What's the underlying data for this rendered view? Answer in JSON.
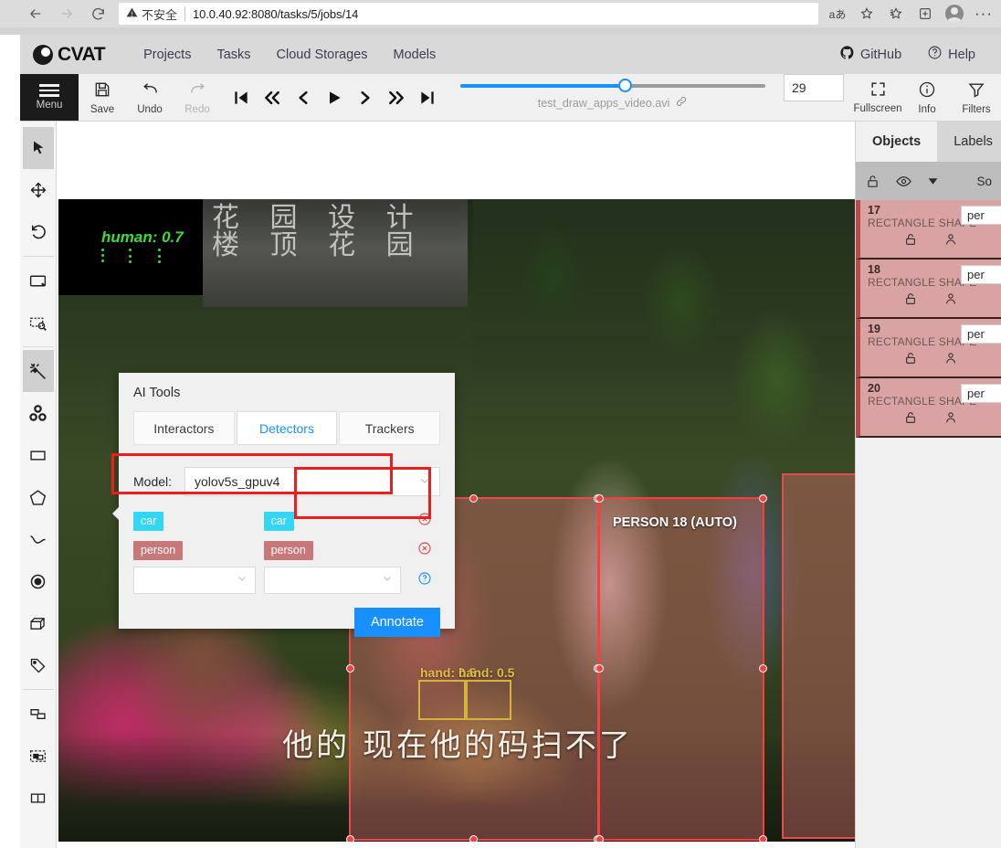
{
  "browser": {
    "back_icon": "arrow-left-icon",
    "forward_icon": "arrow-right-icon",
    "reload_icon": "reload-icon",
    "security_label": "不安全",
    "security_icon": "warning-triangle-icon",
    "url": "10.0.40.92:8080/tasks/5/jobs/14",
    "read_aloud_icon": "read-aloud-icon",
    "favorites_icon": "favorites-star-icon",
    "collections_icon": "collections-icon",
    "add_tab_icon": "add-to-collections-icon",
    "profile_icon": "profile-avatar-icon",
    "more_icon": "more-options-icon"
  },
  "header": {
    "logo_text": "CVAT",
    "nav": [
      {
        "label": "Projects"
      },
      {
        "label": "Tasks"
      },
      {
        "label": "Cloud Storages"
      },
      {
        "label": "Models"
      }
    ],
    "right": [
      {
        "label": "GitHub",
        "icon": "github-icon"
      },
      {
        "label": "Help",
        "icon": "question-circle-icon"
      }
    ]
  },
  "toolbar": {
    "menu_label": "Menu",
    "save_label": "Save",
    "undo_label": "Undo",
    "redo_label": "Redo",
    "player": [
      {
        "name": "first-frame",
        "glyph": "first"
      },
      {
        "name": "backward-jump",
        "glyph": "rewind"
      },
      {
        "name": "previous-frame",
        "glyph": "prev"
      },
      {
        "name": "play",
        "glyph": "play"
      },
      {
        "name": "next-frame",
        "glyph": "next"
      },
      {
        "name": "forward-jump",
        "glyph": "fastforward"
      },
      {
        "name": "last-frame",
        "glyph": "last"
      }
    ],
    "filename": "test_draw_apps_video.avi",
    "link_icon": "link-icon",
    "frame_value": "29",
    "slider_percent": 54,
    "fullscreen_label": "Fullscreen",
    "info_label": "Info",
    "filters_label": "Filters"
  },
  "tools_rail": [
    {
      "name": "cursor-tool",
      "active": true
    },
    {
      "name": "move-image-tool",
      "active": false
    },
    {
      "name": "rotate-tool",
      "active": false
    },
    {
      "name": "fit-image-tool",
      "active": false
    },
    {
      "name": "select-region-tool",
      "active": false
    },
    {
      "name": "ai-tools-magic-wand",
      "active": true
    },
    {
      "name": "opencv-tool",
      "active": false
    },
    {
      "name": "draw-rectangle-tool",
      "active": false
    },
    {
      "name": "draw-polygon-tool",
      "active": false
    },
    {
      "name": "draw-polyline-tool",
      "active": false
    },
    {
      "name": "draw-points-tool",
      "active": false
    },
    {
      "name": "draw-cuboid-tool",
      "active": false
    },
    {
      "name": "setup-tag-tool",
      "active": false
    },
    {
      "name": "merge-shapes-tool",
      "active": false
    },
    {
      "name": "group-shapes-tool",
      "active": false
    },
    {
      "name": "split-track-tool",
      "active": false
    }
  ],
  "ai_tools": {
    "title": "AI Tools",
    "tabs": [
      {
        "label": "Interactors",
        "active": false
      },
      {
        "label": "Detectors",
        "active": true
      },
      {
        "label": "Trackers",
        "active": false
      }
    ],
    "model_label": "Model:",
    "model_value": "yolov5s_gpuv4",
    "mappings": [
      {
        "source": "car",
        "target": "car",
        "color": "#33d6f5"
      },
      {
        "source": "person",
        "target": "person",
        "color": "#c87878"
      }
    ],
    "empty_select_placeholder": "",
    "help_icon": "question-circle-icon",
    "delete_icon": "delete-circle-icon",
    "annotate_label": "Annotate",
    "accent_color": "#1890ff",
    "highlight_color": "#ee1c1c"
  },
  "sidebar": {
    "tabs": [
      {
        "label": "Objects",
        "active": true
      },
      {
        "label": "Labels",
        "active": false
      }
    ],
    "tools": [
      {
        "name": "lock-all-icon"
      },
      {
        "name": "hide-all-icon"
      },
      {
        "name": "collapse-all-icon"
      }
    ],
    "sort_label": "So",
    "objects": [
      {
        "id": "17",
        "type": "RECTANGLE SHAPE",
        "label": "per"
      },
      {
        "id": "18",
        "type": "RECTANGLE SHAPE",
        "label": "per"
      },
      {
        "id": "19",
        "type": "RECTANGLE SHAPE",
        "label": "per"
      },
      {
        "id": "20",
        "type": "RECTANGLE SHAPE",
        "label": "per"
      }
    ]
  },
  "canvas": {
    "sign_text_line1": "花 园 设 计",
    "sign_text_line2": "楼 顶 花 园",
    "subtitle": "他的 现在他的码扫不了",
    "green_annotation": "human: 0.7",
    "selected_box_label": "PERSON 18 (AUTO)",
    "yellow_annotation_1": "hand: 0.5",
    "yellow_annotation_2": "hand: 0.5",
    "box_color": "#e84b4b",
    "selected_color": "#ff3b3b",
    "yellow_color": "#d6b23c"
  }
}
